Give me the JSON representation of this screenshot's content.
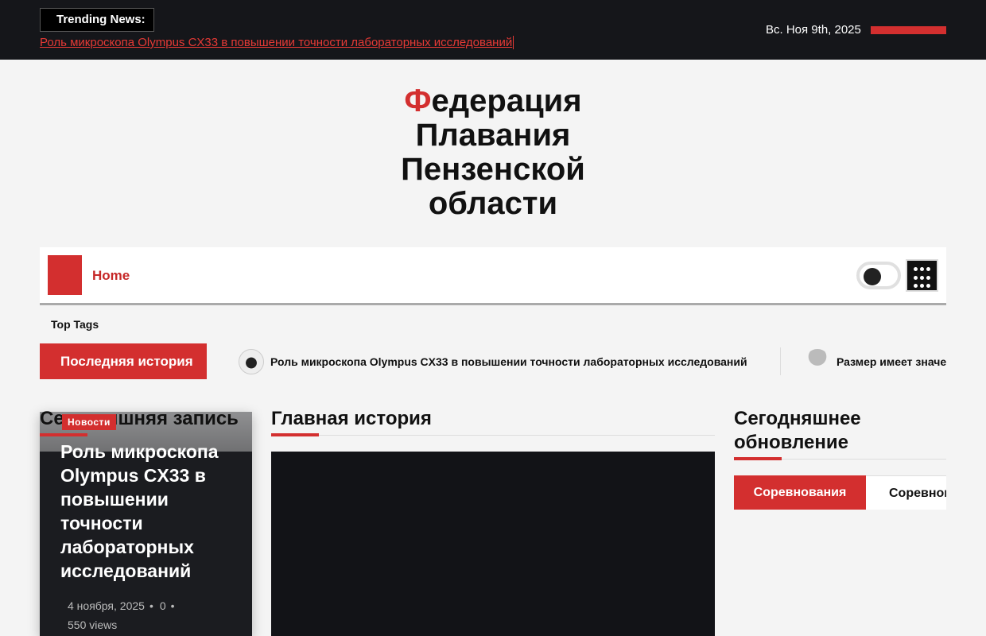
{
  "topbar": {
    "trending_label": "Trending News:",
    "trending_link": "Роль микроскопа Olympus CX33 в повышении точности лабораторных исследований",
    "date": "Вс. Ноя 9th, 2025"
  },
  "logo": {
    "first_letter": "Ф",
    "rest": "едерация Плавания Пензенской области"
  },
  "nav": {
    "home": "Home"
  },
  "top_tags": "Top Tags",
  "latest": {
    "label": "Последняя история",
    "items": [
      {
        "title": "Роль микроскопа Olympus CX33 в повышении точности лабораторных исследований",
        "icon": "microscope-thumb"
      },
      {
        "title": "Размер имеет значение",
        "icon": "article-thumb"
      }
    ]
  },
  "sections": {
    "today_post": "Сегодняшняя запись",
    "main_story": "Главная история",
    "today_update": "Сегодняшнее обновление"
  },
  "featured": {
    "category": "Новости",
    "title": "Роль микроскопа Olympus CX33 в повышении точности лабораторных исследований",
    "date": "4 ноября, 2025",
    "comments": "0",
    "views": "550 views"
  },
  "tabs": [
    {
      "label": "Соревнования",
      "active": true
    },
    {
      "label": "Соревнования",
      "active": false
    }
  ],
  "colors": {
    "accent": "#d32f2f",
    "dark": "#15161a"
  }
}
